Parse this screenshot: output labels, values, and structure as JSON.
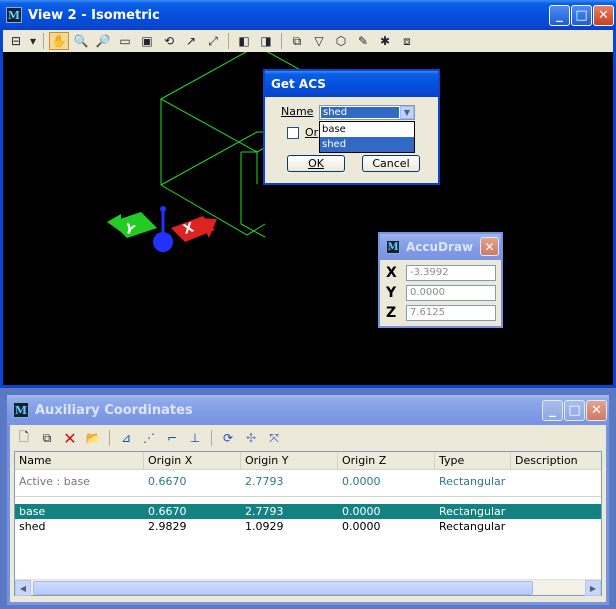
{
  "view2": {
    "title": "View 2 - Isometric",
    "colors": {
      "accent": "#0846cf",
      "canvas": "#000000",
      "geometry": "#22dd22"
    }
  },
  "get_acs": {
    "title": "Get ACS",
    "name_label": "Name",
    "name_value": "shed",
    "options": [
      "base",
      "shed"
    ],
    "origin_label": "Or",
    "ok_label": "OK",
    "cancel_label": "Cancel"
  },
  "accudraw": {
    "title": "AccuDraw",
    "x_label": "X",
    "x_value": "-3.3992",
    "y_label": "Y",
    "y_value": "0.0000",
    "z_label": "Z",
    "z_value": "7.6125"
  },
  "aux": {
    "title": "Auxiliary Coordinates",
    "columns": [
      "Name",
      "Origin X",
      "Origin Y",
      "Origin Z",
      "Type",
      "Description"
    ],
    "active_row": {
      "name": "Active : base",
      "x": "0.6670",
      "y": "2.7793",
      "z": "0.0000",
      "type": "Rectangular"
    },
    "rows": [
      {
        "name": "base",
        "x": "0.6670",
        "y": "2.7793",
        "z": "0.0000",
        "type": "Rectangular"
      },
      {
        "name": "shed",
        "x": "2.9829",
        "y": "1.0929",
        "z": "0.0000",
        "type": "Rectangular"
      }
    ]
  }
}
